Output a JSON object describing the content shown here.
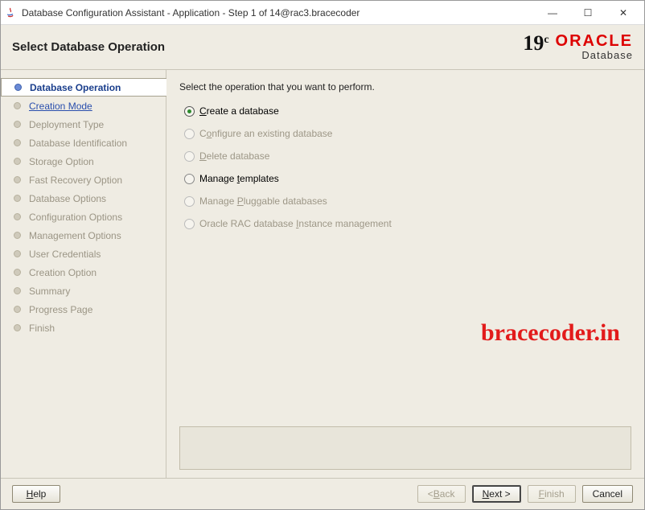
{
  "window": {
    "title": "Database Configuration Assistant - Application - Step 1 of 14@rac3.bracecoder"
  },
  "header": {
    "title": "Select Database Operation",
    "brand_version": "19",
    "brand_version_suffix": "c",
    "brand_name": "ORACLE",
    "brand_product": "Database"
  },
  "sidebar": {
    "steps": [
      {
        "label": "Database Operation",
        "state": "active"
      },
      {
        "label": "Creation Mode",
        "state": "link"
      },
      {
        "label": "Deployment Type",
        "state": "disabled"
      },
      {
        "label": "Database Identification",
        "state": "disabled"
      },
      {
        "label": "Storage Option",
        "state": "disabled"
      },
      {
        "label": "Fast Recovery Option",
        "state": "disabled"
      },
      {
        "label": "Database Options",
        "state": "disabled"
      },
      {
        "label": "Configuration Options",
        "state": "disabled"
      },
      {
        "label": "Management Options",
        "state": "disabled"
      },
      {
        "label": "User Credentials",
        "state": "disabled"
      },
      {
        "label": "Creation Option",
        "state": "disabled"
      },
      {
        "label": "Summary",
        "state": "disabled"
      },
      {
        "label": "Progress Page",
        "state": "disabled"
      },
      {
        "label": "Finish",
        "state": "disabled"
      }
    ]
  },
  "content": {
    "prompt": "Select the operation that you want to perform.",
    "options": [
      {
        "pre": "",
        "mnemonic": "C",
        "post": "reate a database",
        "selected": true,
        "enabled": true
      },
      {
        "pre": "C",
        "mnemonic": "o",
        "post": "nfigure an existing database",
        "selected": false,
        "enabled": false
      },
      {
        "pre": "",
        "mnemonic": "D",
        "post": "elete database",
        "selected": false,
        "enabled": false
      },
      {
        "pre": "Manage ",
        "mnemonic": "t",
        "post": "emplates",
        "selected": false,
        "enabled": true
      },
      {
        "pre": "Manage ",
        "mnemonic": "P",
        "post": "luggable databases",
        "selected": false,
        "enabled": false
      },
      {
        "pre": "Oracle RAC database ",
        "mnemonic": "I",
        "post": "nstance management",
        "selected": false,
        "enabled": false
      }
    ]
  },
  "watermark": "bracecoder.in",
  "footer": {
    "help": {
      "pre": "",
      "mnemonic": "H",
      "post": "elp"
    },
    "back": {
      "pre": "< ",
      "mnemonic": "B",
      "post": "ack"
    },
    "next": {
      "pre": "",
      "mnemonic": "N",
      "post": "ext >"
    },
    "finish": {
      "pre": "",
      "mnemonic": "F",
      "post": "inish"
    },
    "cancel": {
      "label": "Cancel"
    }
  }
}
